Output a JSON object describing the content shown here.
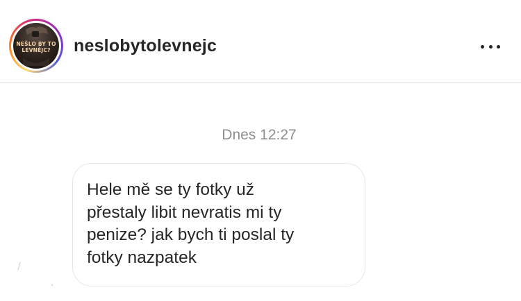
{
  "header": {
    "avatar_logo_text": "NEŠLO BY TO\nLEVNĚJC?",
    "username": "neslobytolevnejc",
    "more_icon": "more-horizontal-icon"
  },
  "chat": {
    "timestamp": "Dnes 12:27",
    "messages": [
      {
        "text": "Hele mě se ty fotky už\npřestaly libit nevratis mi ty\npenize? jak bych ti poslal ty\nfotky nazpatek"
      }
    ]
  },
  "colors": {
    "text": "#262626",
    "secondary_text": "#8e8e8e",
    "bubble_border": "#e6e6e6",
    "divider": "#dbdbdb"
  }
}
